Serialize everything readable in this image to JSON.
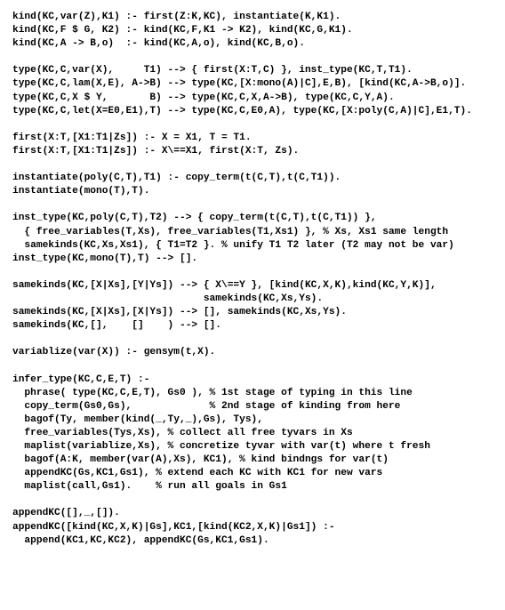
{
  "code_lines": [
    "kind(KC,var(Z),K1) :- first(Z:K,KC), instantiate(K,K1).",
    "kind(KC,F $ G, K2) :- kind(KC,F,K1 -> K2), kind(KC,G,K1).",
    "kind(KC,A -> B,o)  :- kind(KC,A,o), kind(KC,B,o).",
    "",
    "type(KC,C,var(X),     T1) --> { first(X:T,C) }, inst_type(KC,T,T1).",
    "type(KC,C,lam(X,E), A->B) --> type(KC,[X:mono(A)|C],E,B), [kind(KC,A->B,o)].",
    "type(KC,C,X $ Y,       B) --> type(KC,C,X,A->B), type(KC,C,Y,A).",
    "type(KC,C,let(X=E0,E1),T) --> type(KC,C,E0,A), type(KC,[X:poly(C,A)|C],E1,T).",
    "",
    "first(X:T,[X1:T1|Zs]) :- X = X1, T = T1.",
    "first(X:T,[X1:T1|Zs]) :- X\\==X1, first(X:T, Zs).",
    "",
    "instantiate(poly(C,T),T1) :- copy_term(t(C,T),t(C,T1)).",
    "instantiate(mono(T),T).",
    "",
    "inst_type(KC,poly(C,T),T2) --> { copy_term(t(C,T),t(C,T1)) },",
    "  { free_variables(T,Xs), free_variables(T1,Xs1) }, % Xs, Xs1 same length",
    "  samekinds(KC,Xs,Xs1), { T1=T2 }. % unify T1 T2 later (T2 may not be var)",
    "inst_type(KC,mono(T),T) --> [].",
    "",
    "samekinds(KC,[X|Xs],[Y|Ys]) --> { X\\==Y }, [kind(KC,X,K),kind(KC,Y,K)],",
    "                                samekinds(KC,Xs,Ys).",
    "samekinds(KC,[X|Xs],[X|Ys]) --> [], samekinds(KC,Xs,Ys).",
    "samekinds(KC,[],    []    ) --> [].",
    "",
    "variablize(var(X)) :- gensym(t,X).",
    "",
    "infer_type(KC,C,E,T) :-",
    "  phrase( type(KC,C,E,T), Gs0 ), % 1st stage of typing in this line",
    "  copy_term(Gs0,Gs),             % 2nd stage of kinding from here",
    "  bagof(Ty, member(kind(_,Ty,_),Gs), Tys),",
    "  free_variables(Tys,Xs), % collect all free tyvars in Xs",
    "  maplist(variablize,Xs), % concretize tyvar with var(t) where t fresh",
    "  bagof(A:K, member(var(A),Xs), KC1), % kind bindngs for var(t)",
    "  appendKC(Gs,KC1,Gs1), % extend each KC with KC1 for new vars",
    "  maplist(call,Gs1).    % run all goals in Gs1",
    "",
    "appendKC([],_,[]).",
    "appendKC([kind(KC,X,K)|Gs],KC1,[kind(KC2,X,K)|Gs1]) :-",
    "  append(KC1,KC,KC2), appendKC(Gs,KC1,Gs1)."
  ]
}
